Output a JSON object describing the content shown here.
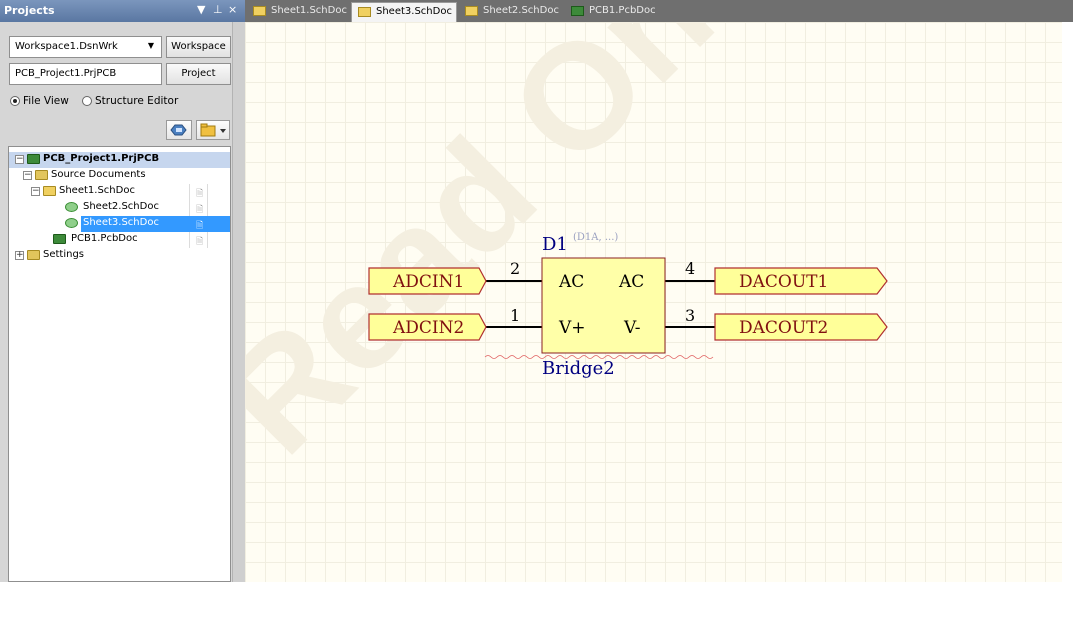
{
  "panel": {
    "title": "Projects",
    "controls": [
      "▼",
      "⊥",
      "×"
    ],
    "workspace_value": "Workspace1.DsnWrk",
    "workspace_button": "Workspace",
    "project_value": "PCB_Project1.PrjPCB",
    "project_button": "Project",
    "view_options": [
      {
        "label": "File View",
        "selected": true
      },
      {
        "label": "Structure Editor",
        "selected": false
      }
    ],
    "toolbar_icons": [
      "compile-icon",
      "folder-options-icon"
    ]
  },
  "tree": [
    {
      "label": "PCB_Project1.PrjPCB",
      "icon": "pcb-project-icon",
      "expander": "−",
      "bold": true,
      "highlight": true
    },
    {
      "label": "Source Documents",
      "icon": "folder-icon",
      "expander": "−"
    },
    {
      "label": "Sheet1.SchDoc",
      "icon": "schematic-doc-icon",
      "expander": "−"
    },
    {
      "label": "Sheet2.SchDoc",
      "icon": "sheet-reference-icon"
    },
    {
      "label": "Sheet3.SchDoc",
      "icon": "sheet-reference-icon",
      "selected": true
    },
    {
      "label": "PCB1.PcbDoc",
      "icon": "pcb-doc-icon"
    },
    {
      "label": "Settings",
      "icon": "folder-icon",
      "expander": "+"
    }
  ],
  "tabs": [
    {
      "label": "Sheet1.SchDoc",
      "icon": "schematic-doc-icon",
      "active": false
    },
    {
      "label": "Sheet3.SchDoc",
      "icon": "schematic-doc-icon",
      "active": true
    },
    {
      "label": "Sheet2.SchDoc",
      "icon": "schematic-doc-icon",
      "active": false
    },
    {
      "label": "PCB1.PcbDoc",
      "icon": "pcb-doc-icon",
      "active": false
    }
  ],
  "schematic": {
    "watermark": "Read Only",
    "component": {
      "designator": "D1",
      "part_hint": "(D1A, ...)",
      "comment": "Bridge2",
      "pins": [
        {
          "number": "2",
          "name": "AC"
        },
        {
          "number": "1",
          "name": "V+"
        },
        {
          "number": "4",
          "name": "AC"
        },
        {
          "number": "3",
          "name": "V-"
        }
      ]
    },
    "ports": [
      "ADCIN1",
      "ADCIN2",
      "DACOUT1",
      "DACOUT2"
    ],
    "colors": {
      "port_fill": "#ffff99",
      "port_border": "#b03030",
      "port_text": "#801010",
      "designator_text": "#000080",
      "component_fill": "#ffffa8"
    }
  }
}
